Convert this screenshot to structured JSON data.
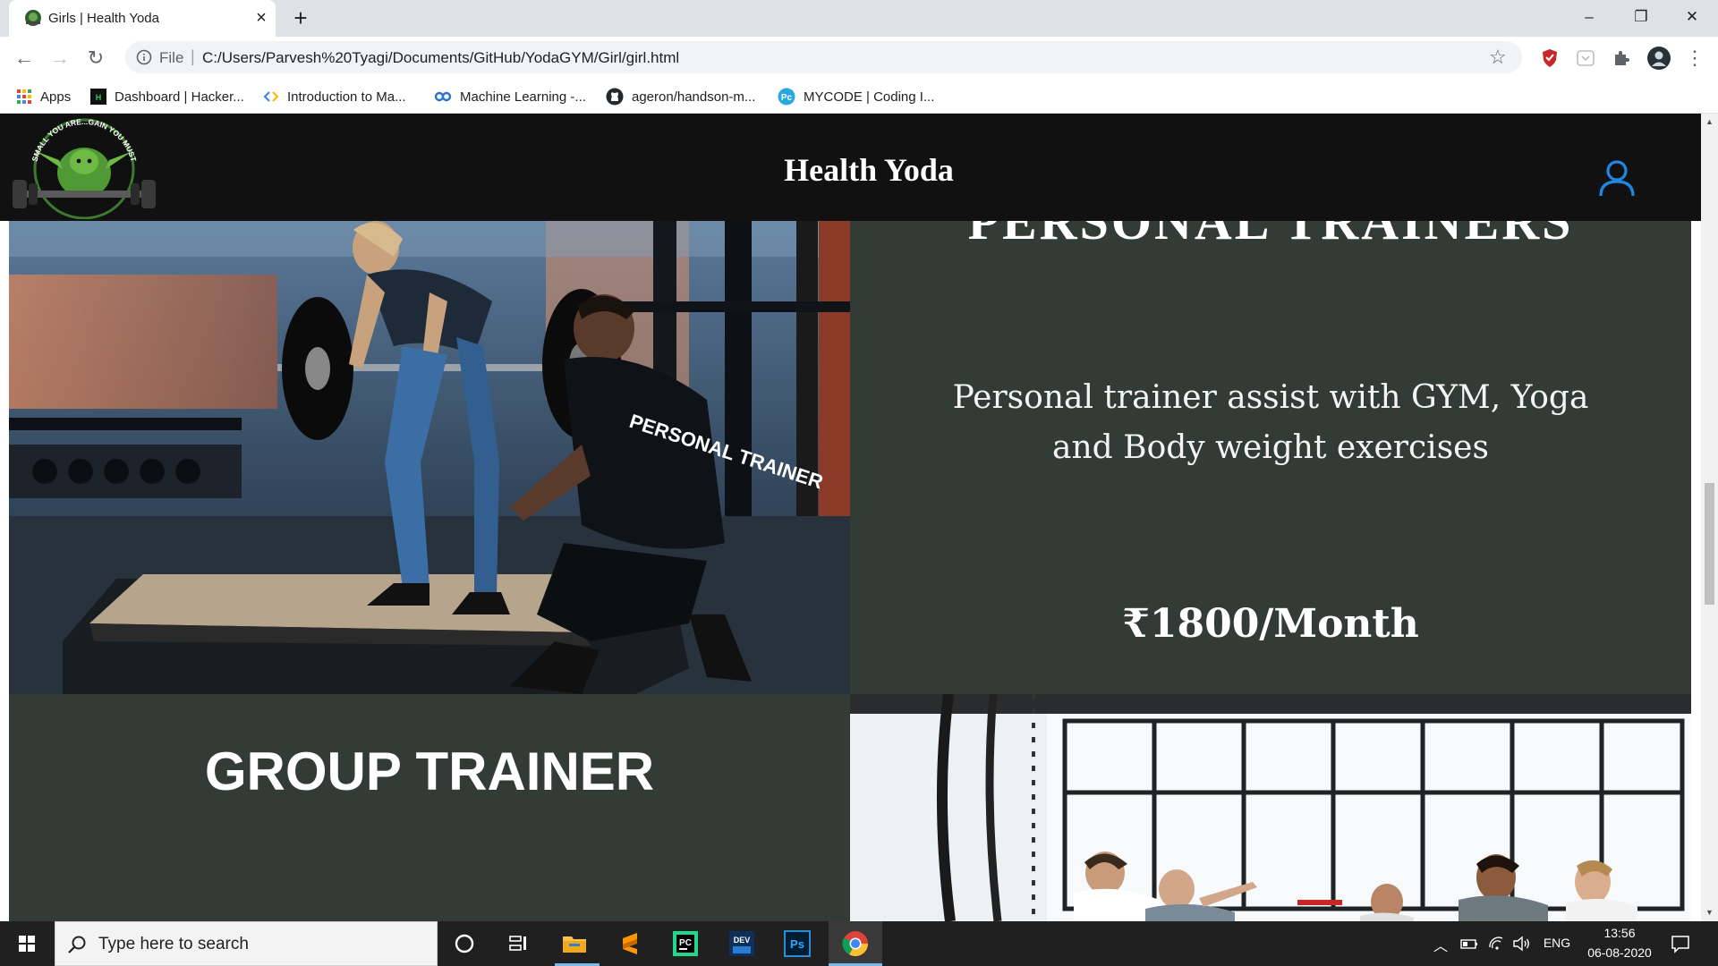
{
  "browser": {
    "tab_title": "Girls | Health Yoda",
    "new_tab": "+",
    "scheme_label": "File",
    "url": "C:/Users/Parvesh%20Tyagi/Documents/GitHub/YodaGYM/Girl/girl.html",
    "bookmarks": [
      {
        "label": "Apps",
        "icon": "apps-grid-icon"
      },
      {
        "label": "Dashboard | Hacker...",
        "icon": "hackerrank-icon"
      },
      {
        "label": "Introduction to Ma...",
        "icon": "code-brackets-icon"
      },
      {
        "label": "Machine Learning -...",
        "icon": "coursera-infinity-icon"
      },
      {
        "label": "ageron/handson-m...",
        "icon": "github-icon"
      },
      {
        "label": "MYCODE | Coding I...",
        "icon": "mycode-icon"
      }
    ]
  },
  "site": {
    "title": "Health Yoda",
    "logo_text": "SMALL YOU ARE...GAIN YOU MUST",
    "personal_trainers": {
      "title": "PERSONAL TRAINERS",
      "description": "Personal trainer assist with GYM, Yoga and Body weight exercises",
      "price": "₹1800/Month",
      "image_text": "PERSONAL TRAINER"
    },
    "group_trainer": {
      "title": "GROUP TRAINER"
    }
  },
  "taskbar": {
    "search_placeholder": "Type here to search",
    "language": "ENG",
    "time": "13:56",
    "date": "06-08-2020"
  },
  "colors": {
    "header_bg": "#111111",
    "panel_bg": "#333b36",
    "user_icon": "#1e88e5",
    "taskbar_bg": "#202020"
  }
}
